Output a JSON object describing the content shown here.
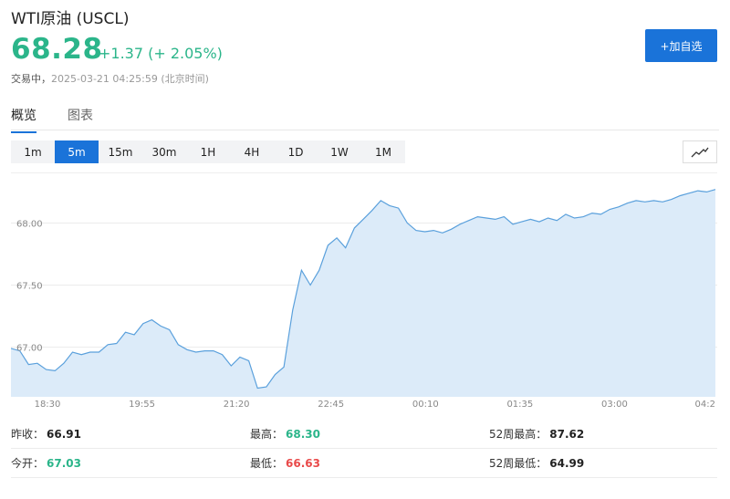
{
  "header": {
    "title": "WTI原油 (USCL)",
    "price": "68.28",
    "change": "+1.37 (+ 2.05%)",
    "status_label": "交易中，",
    "timestamp": "2025-03-21 04:25:59 (北京时间)",
    "add_button_label": "+加自选"
  },
  "tabs": [
    {
      "label": "概览",
      "active": true
    },
    {
      "label": "图表",
      "active": false
    }
  ],
  "ranges": [
    {
      "label": "1m",
      "active": false
    },
    {
      "label": "5m",
      "active": true
    },
    {
      "label": "15m",
      "active": false
    },
    {
      "label": "30m",
      "active": false
    },
    {
      "label": "1H",
      "active": false
    },
    {
      "label": "4H",
      "active": false
    },
    {
      "label": "1D",
      "active": false
    },
    {
      "label": "1W",
      "active": false
    },
    {
      "label": "1M",
      "active": false
    }
  ],
  "chart_data": {
    "type": "area",
    "x_ticks": [
      "18:30",
      "19:55",
      "21:20",
      "22:45",
      "00:10",
      "01:35",
      "03:00",
      "04:2"
    ],
    "y_ticks": [
      "67.00",
      "67.50",
      "68.00"
    ],
    "ylim": [
      66.6,
      68.4
    ],
    "colors": {
      "line": "#5aa0dc",
      "fill": "#dcebf9"
    },
    "values": [
      66.99,
      66.97,
      66.86,
      66.87,
      66.82,
      66.81,
      66.87,
      66.96,
      66.94,
      66.96,
      66.96,
      67.02,
      67.03,
      67.12,
      67.1,
      67.19,
      67.22,
      67.17,
      67.14,
      67.02,
      66.98,
      66.96,
      66.97,
      66.97,
      66.94,
      66.85,
      66.92,
      66.89,
      66.67,
      66.68,
      66.78,
      66.84,
      67.3,
      67.62,
      67.5,
      67.62,
      67.82,
      67.88,
      67.8,
      67.96,
      68.03,
      68.1,
      68.18,
      68.14,
      68.12,
      68.0,
      67.94,
      67.93,
      67.94,
      67.92,
      67.95,
      67.99,
      68.02,
      68.05,
      68.04,
      68.03,
      68.05,
      67.99,
      68.01,
      68.03,
      68.01,
      68.04,
      68.02,
      68.07,
      68.04,
      68.05,
      68.08,
      68.07,
      68.11,
      68.13,
      68.16,
      68.18,
      68.17,
      68.18,
      68.17,
      68.19,
      68.22,
      68.24,
      68.26,
      68.25,
      68.27
    ]
  },
  "stats": [
    [
      {
        "label": "昨收：",
        "value": "66.91",
        "tone": "neutral"
      },
      {
        "label": "最高：",
        "value": "68.30",
        "tone": "up"
      },
      {
        "label": "52周最高：",
        "value": "87.62",
        "tone": "neutral"
      }
    ],
    [
      {
        "label": "今开：",
        "value": "67.03",
        "tone": "up"
      },
      {
        "label": "最低：",
        "value": "66.63",
        "tone": "down"
      },
      {
        "label": "52周最低：",
        "value": "64.99",
        "tone": "neutral"
      }
    ]
  ]
}
